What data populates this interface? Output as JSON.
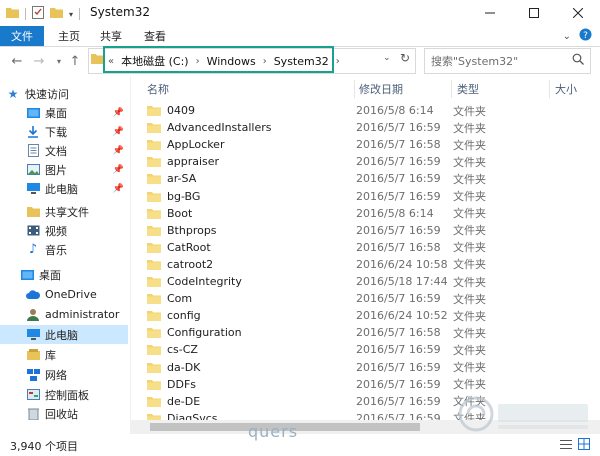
{
  "window": {
    "title": "System32"
  },
  "ribbon": {
    "tabs": [
      "文件",
      "主页",
      "共享",
      "查看"
    ]
  },
  "address": {
    "crumbs": [
      "本地磁盘 (C:)",
      "Windows",
      "System32"
    ]
  },
  "search": {
    "placeholder": "搜索\"System32\""
  },
  "nav": {
    "quick_access": "快速访问",
    "pinned": [
      {
        "label": "桌面",
        "icon": "desktop-icon"
      },
      {
        "label": "下载",
        "icon": "download-icon"
      },
      {
        "label": "文档",
        "icon": "document-icon"
      },
      {
        "label": "图片",
        "icon": "picture-icon"
      },
      {
        "label": "此电脑",
        "icon": "computer-icon"
      }
    ],
    "items": [
      {
        "label": "共享文件",
        "icon": "folder-icon"
      },
      {
        "label": "视频",
        "icon": "video-icon"
      },
      {
        "label": "音乐",
        "icon": "music-icon"
      }
    ],
    "tree": [
      {
        "label": "桌面",
        "icon": "desktop-icon"
      },
      {
        "label": "OneDrive",
        "icon": "cloud-icon"
      },
      {
        "label": "administrator",
        "icon": "user-icon"
      },
      {
        "label": "此电脑",
        "icon": "computer-icon"
      },
      {
        "label": "库",
        "icon": "library-icon"
      },
      {
        "label": "网络",
        "icon": "network-icon"
      },
      {
        "label": "控制面板",
        "icon": "control-panel-icon"
      },
      {
        "label": "回收站",
        "icon": "recycle-bin-icon"
      }
    ]
  },
  "columns": {
    "name": "名称",
    "date": "修改日期",
    "type": "类型",
    "size": "大小"
  },
  "files": [
    {
      "name": "0409",
      "date": "2016/5/8 6:14",
      "type": "文件夹"
    },
    {
      "name": "AdvancedInstallers",
      "date": "2016/5/7 16:59",
      "type": "文件夹"
    },
    {
      "name": "AppLocker",
      "date": "2016/5/7 16:58",
      "type": "文件夹"
    },
    {
      "name": "appraiser",
      "date": "2016/5/7 16:59",
      "type": "文件夹"
    },
    {
      "name": "ar-SA",
      "date": "2016/5/7 16:59",
      "type": "文件夹"
    },
    {
      "name": "bg-BG",
      "date": "2016/5/7 16:59",
      "type": "文件夹"
    },
    {
      "name": "Boot",
      "date": "2016/5/8 6:14",
      "type": "文件夹"
    },
    {
      "name": "Bthprops",
      "date": "2016/5/7 16:59",
      "type": "文件夹"
    },
    {
      "name": "CatRoot",
      "date": "2016/5/7 16:58",
      "type": "文件夹"
    },
    {
      "name": "catroot2",
      "date": "2016/6/24 10:58",
      "type": "文件夹"
    },
    {
      "name": "CodeIntegrity",
      "date": "2016/5/18 17:44",
      "type": "文件夹"
    },
    {
      "name": "Com",
      "date": "2016/5/7 16:59",
      "type": "文件夹"
    },
    {
      "name": "config",
      "date": "2016/6/24 10:52",
      "type": "文件夹"
    },
    {
      "name": "Configuration",
      "date": "2016/5/7 16:58",
      "type": "文件夹"
    },
    {
      "name": "cs-CZ",
      "date": "2016/5/7 16:59",
      "type": "文件夹"
    },
    {
      "name": "da-DK",
      "date": "2016/5/7 16:59",
      "type": "文件夹"
    },
    {
      "name": "DDFs",
      "date": "2016/5/7 16:59",
      "type": "文件夹"
    },
    {
      "name": "de-DE",
      "date": "2016/5/7 16:59",
      "type": "文件夹"
    },
    {
      "name": "DiagSvcs",
      "date": "2016/5/7 16:59",
      "type": "文件夹"
    }
  ],
  "status": {
    "item_count": "3,940 个项目"
  },
  "watermark": {
    "text": "quers"
  },
  "colors": {
    "accent": "#1979ca",
    "highlight": "#17a28f",
    "folder": "#f3d36b",
    "selected": "#cce8ff"
  }
}
